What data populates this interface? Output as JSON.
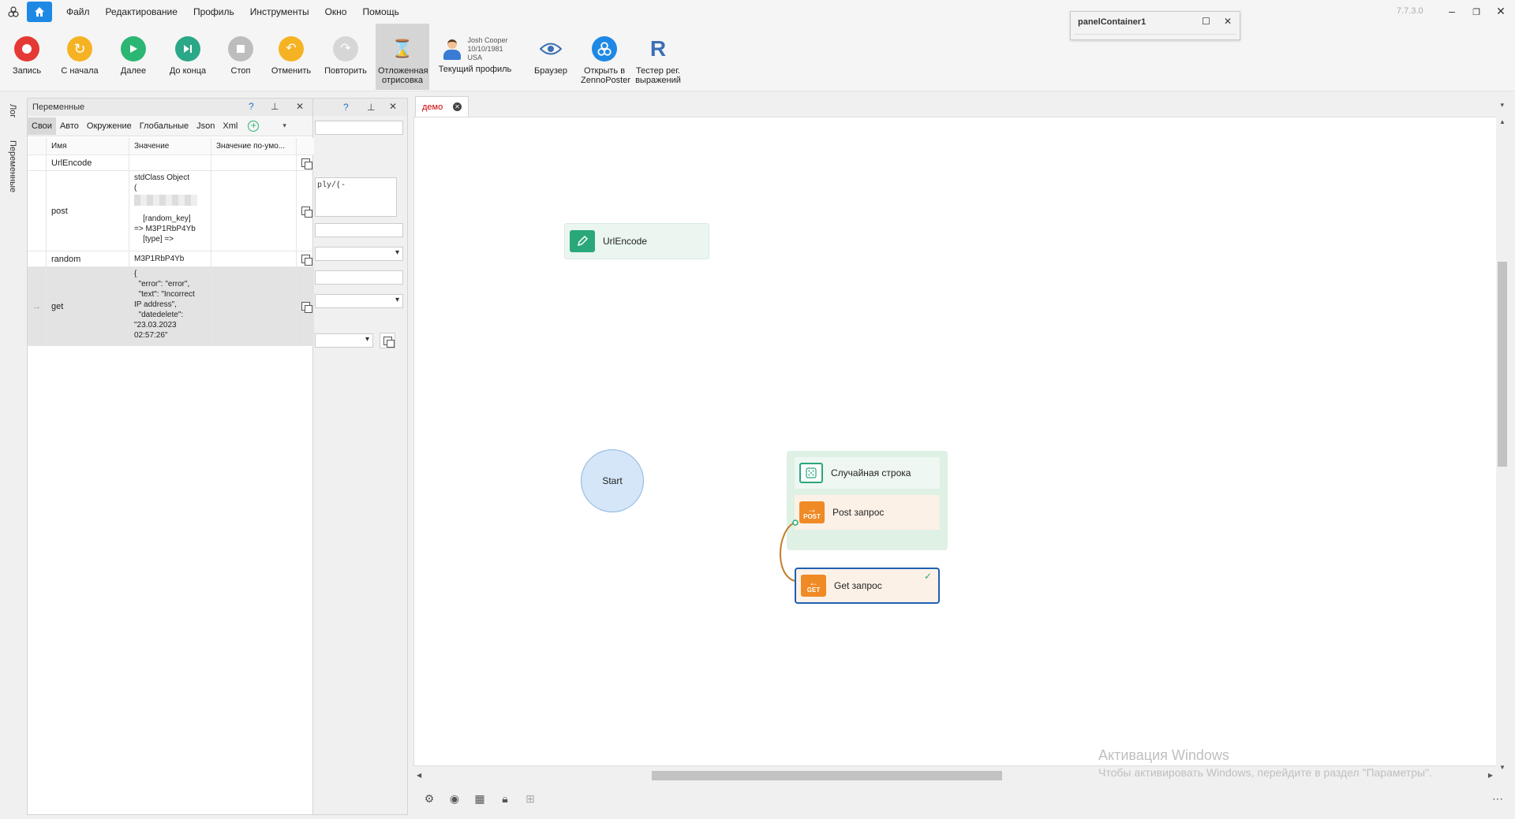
{
  "menubar": {
    "items": [
      "Файл",
      "Редактирование",
      "Профиль",
      "Инструменты",
      "Окно",
      "Помощь"
    ],
    "version": "7.7.3.0"
  },
  "panel_container": {
    "title": "panelContainer1"
  },
  "toolbar": {
    "record": "Запись",
    "from_start": "С начала",
    "next": "Далее",
    "to_end": "До конца",
    "stop": "Стоп",
    "undo": "Отменить",
    "redo": "Повторить",
    "deferred": "Отложенная отрисовка",
    "profile_name": "Josh Cooper",
    "profile_dob": "10/10/1981",
    "profile_country": "USA",
    "current_profile": "Текущий профиль",
    "browser": "Браузер",
    "open_in": "Открыть в ZennoPoster",
    "regex_tester": "Тестер рег. выражений"
  },
  "side_tabs": {
    "log": "Лог",
    "variables": "Переменные"
  },
  "variables_panel": {
    "title": "Переменные",
    "help": "?",
    "tabs": [
      "Свои",
      "Авто",
      "Окружение",
      "Глобальные",
      "Json",
      "Xml"
    ],
    "columns": {
      "name": "Имя",
      "value": "Значение",
      "default": "Значение по-умо..."
    },
    "rows": [
      {
        "name": "UrlEncode",
        "value": ""
      },
      {
        "name": "post",
        "value": "stdClass Object\n(\n\n\n    [random_key]\n=> M3P1RbP4Yb\n    [type] =>"
      },
      {
        "name": "random",
        "value": "M3P1RbP4Yb"
      },
      {
        "name": "get",
        "value": "{\n  \"error\": \"error\",\n  \"text\": \"Incorrect\nIP address\",\n  \"datedelete\":\n\"23.03.2023\n02:57:26\""
      }
    ]
  },
  "panel2": {
    "help": "?",
    "code_snippet": "ply/(-"
  },
  "document": {
    "tab": "демо"
  },
  "canvas": {
    "start": "Start",
    "urlencode": "UrlEncode",
    "random_string": "Случайная строка",
    "post_request": "Post запрос",
    "post_badge": "POST",
    "get_request": "Get запрос",
    "get_badge": "GET"
  },
  "watermark": {
    "title": "Активация Windows",
    "text": "Чтобы активировать Windows, перейдите в раздел \"Параметры\"."
  },
  "colors": {
    "accent": "#1e88e5",
    "record": "#e53935",
    "play": "#2bb673",
    "orange": "#f08a24",
    "node_blue": "#1e5fb4"
  }
}
